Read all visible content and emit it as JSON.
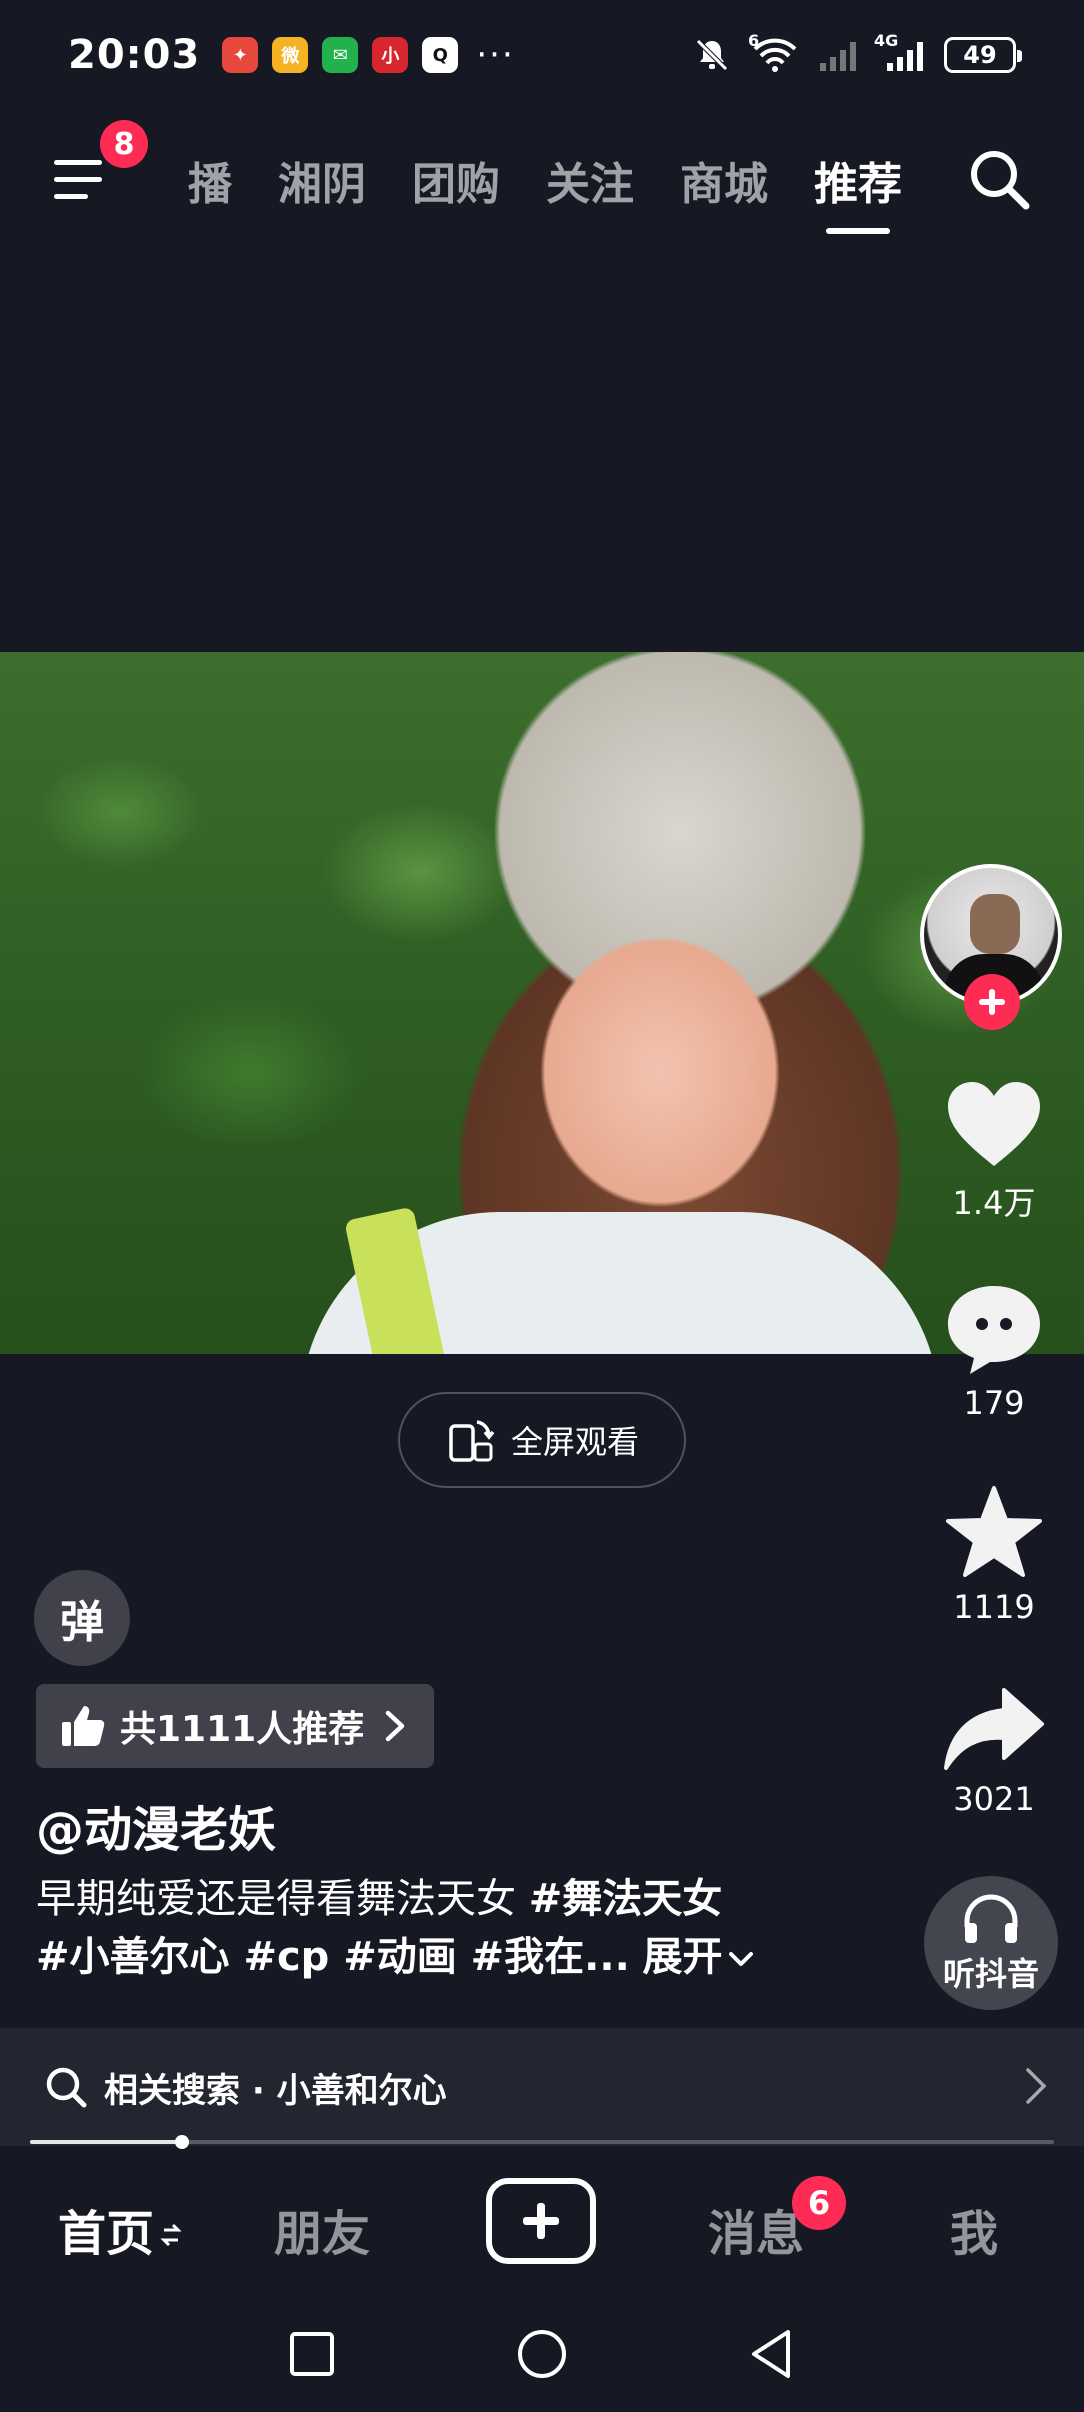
{
  "status_bar": {
    "time": "20:03",
    "apps": [
      {
        "name": "app-red",
        "color": "#e6483d",
        "glyph": "✦"
      },
      {
        "name": "weibo",
        "color": "#f5b323",
        "glyph": "微"
      },
      {
        "name": "wechat",
        "color": "#22b14c",
        "glyph": "✉"
      },
      {
        "name": "app-red2",
        "color": "#d8262e",
        "glyph": "小"
      },
      {
        "name": "qq",
        "color": "#ffffff",
        "glyph": "Q"
      }
    ],
    "more": "···",
    "network_labels": [
      "6",
      "4G"
    ],
    "battery": "49"
  },
  "top_nav": {
    "menu_badge": "8",
    "tabs": [
      "直播",
      "湘阴",
      "团购",
      "关注",
      "商城",
      "推荐"
    ],
    "active_tab": "推荐"
  },
  "video": {
    "fullscreen_label": "全屏观看"
  },
  "rail": {
    "like_count": "1.4万",
    "comment_count": "179",
    "favorite_count": "1119",
    "share_count": "3021",
    "listen_label": "听抖音"
  },
  "info": {
    "danmu_label": "弹",
    "recommend_label": "共1111人推荐",
    "author": "@动漫老妖",
    "desc_text": "早期纯爱还是得看舞法天女 ",
    "desc_tag1": "#舞法天女",
    "desc_tags2": "#小善尔心 #cp #动画 #我在...",
    "desc_more": "展开"
  },
  "related_search": {
    "label": "相关搜索 · 小善和尔心"
  },
  "progress": {
    "fraction": 0.148
  },
  "bottom_nav": {
    "home": "首页",
    "friends": "朋友",
    "messages": "消息",
    "messages_badge": "6",
    "me": "我"
  },
  "colors": {
    "background": "#161823",
    "accent": "#fe2c55"
  }
}
